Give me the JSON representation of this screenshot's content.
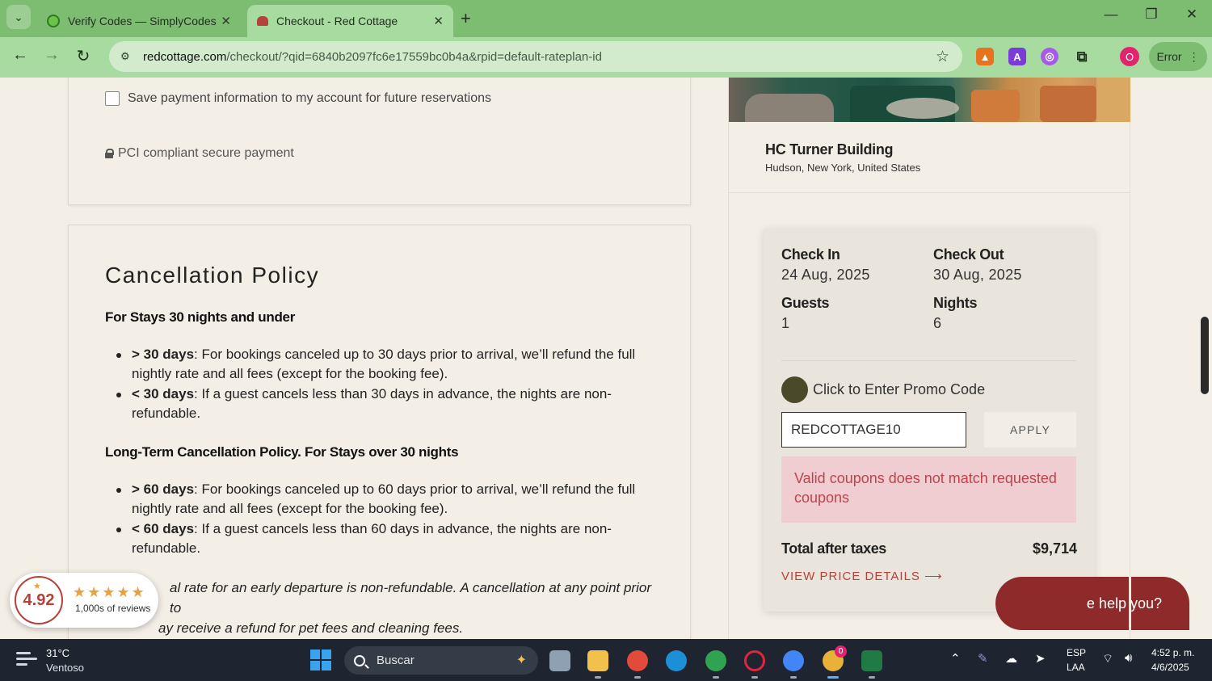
{
  "browser": {
    "tabs": [
      {
        "title": "Verify Codes — SimplyCodes",
        "active": false
      },
      {
        "title": "Checkout - Red Cottage",
        "active": true
      }
    ],
    "url_host": "redcottage.com",
    "url_path": "/checkout/?qid=6840b2097fc6e17559bc0b4a&rpid=default-rateplan-id",
    "profile_initial": "O",
    "error_label": "Error",
    "new_tab_symbol": "+",
    "close_symbol": "✕"
  },
  "payment": {
    "save_payment_label": "Save payment information to my account for future reservations",
    "pci_label": "PCI compliant secure payment"
  },
  "policy": {
    "title": "Cancellation Policy",
    "short_heading": "For Stays 30 nights and under",
    "short_items": [
      {
        "bold": "> 30 days",
        "text": ": For bookings canceled up to 30 days prior to arrival, we’ll refund the full nightly rate and all fees (except for the booking fee)."
      },
      {
        "bold": "< 30 days",
        "text": ": If a guest cancels less than 30 days in advance, the nights are non-refundable."
      }
    ],
    "long_heading": "Long-Term Cancellation Policy. For Stays over 30 nights",
    "long_items": [
      {
        "bold": "> 60 days",
        "text": ": For bookings canceled up to 60 days prior to arrival, we’ll refund the full nightly rate and all fees (except for the booking fee)."
      },
      {
        "bold": "< 60 days",
        "text": ": If a guest cancels less than 60 days in advance, the nights are non-refundable."
      }
    ],
    "note_line1": "al rate for an early departure is non-refundable. A cancellation at any point prior to",
    "note_line2": "ay receive a refund for pet fees and cleaning fees."
  },
  "rating": {
    "score": "4.92",
    "stars": "★★★★★",
    "count": "1,000s of reviews"
  },
  "property": {
    "name": "HC Turner Building",
    "location": "Hudson, New York, United States"
  },
  "booking": {
    "check_in_label": "Check In",
    "check_in_value": "24 Aug, 2025",
    "check_out_label": "Check Out",
    "check_out_value": "30 Aug, 2025",
    "guests_label": "Guests",
    "guests_value": "1",
    "nights_label": "Nights",
    "nights_value": "6",
    "promo_label": "Click to Enter Promo Code",
    "promo_value": "REDCOTTAGE10",
    "apply_label": "APPLY",
    "error_message": "Valid coupons does not match requested coupons",
    "total_label": "Total after taxes",
    "total_value": "$9,714",
    "price_details_label": "VIEW PRICE DETAILS ⟶"
  },
  "chat": {
    "visible_text": "e help you?"
  },
  "taskbar": {
    "temperature": "31°C",
    "condition": "Ventoso",
    "search_placeholder": "Buscar",
    "lang_line1": "ESP",
    "lang_line2": "LAA",
    "time": "4:52 p. m.",
    "date": "4/6/2025",
    "chrome_badge": "0"
  },
  "colors": {
    "accent": "#b8403a",
    "browser_frame": "#7cbd72",
    "error_bg": "#efcdd0",
    "error_text": "#c1434c",
    "page_bg": "#f3eee6"
  }
}
